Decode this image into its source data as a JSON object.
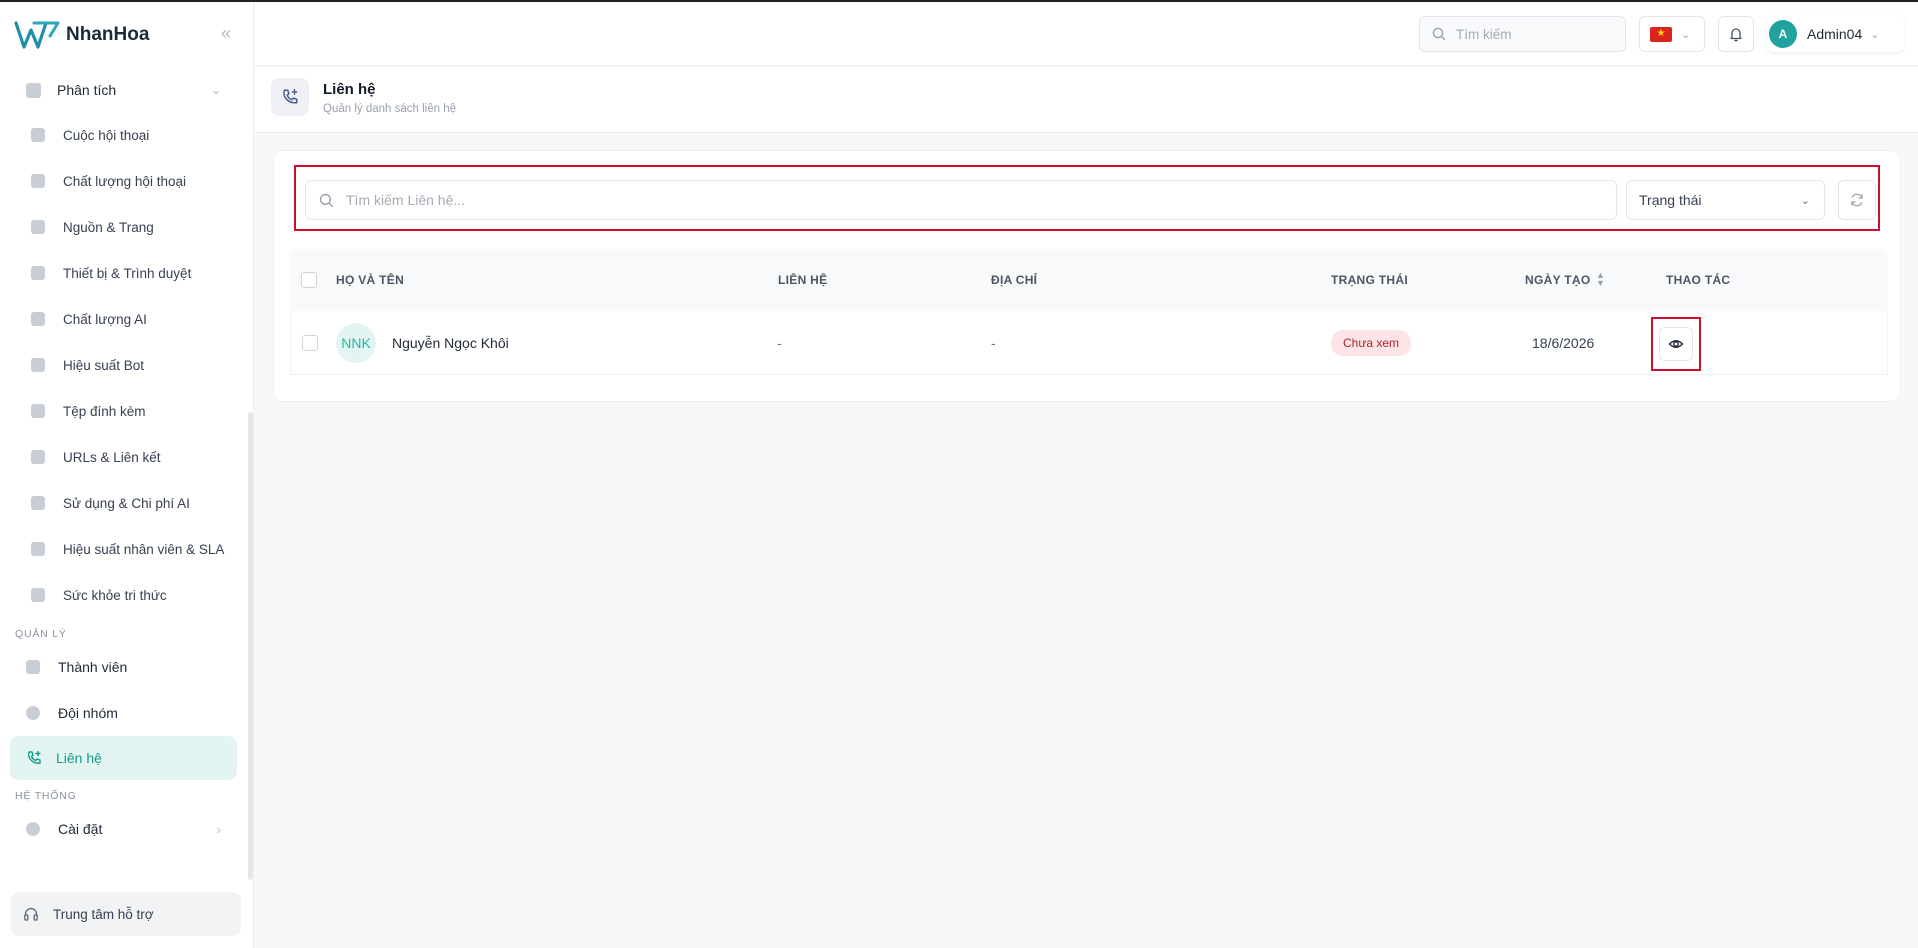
{
  "brand": {
    "name": "NhanHoa",
    "collapse_glyph": "«"
  },
  "sidebar": {
    "analytics_group": "Phân tích",
    "analytics_items": [
      {
        "label": "Cuộc hội thoại",
        "icon": "chat-bubbles-icon"
      },
      {
        "label": "Chất lượng hội thoại",
        "icon": "message-square-icon"
      },
      {
        "label": "Nguồn & Trang",
        "icon": "monitor-icon"
      },
      {
        "label": "Thiết bị & Trình duyệt",
        "icon": "phone-device-icon"
      },
      {
        "label": "Chất lượng AI",
        "icon": "sparkles-icon"
      },
      {
        "label": "Hiệu suất Bot",
        "icon": "cpu-icon"
      },
      {
        "label": "Tệp đính kèm",
        "icon": "file-icon"
      },
      {
        "label": "URLs & Liên kết",
        "icon": "link-icon"
      },
      {
        "label": "Sử dụng & Chi phí AI",
        "icon": "database-icon"
      },
      {
        "label": "Hiệu suất nhân viên & SLA",
        "icon": "users-icon"
      },
      {
        "label": "Sức khỏe tri thức",
        "icon": "book-icon"
      }
    ],
    "section_manage": "QUẢN LÝ",
    "manage_items": [
      {
        "label": "Thành viên",
        "icon": "user-card-icon"
      },
      {
        "label": "Đội nhóm",
        "icon": "team-icon"
      },
      {
        "label": "Liên hệ",
        "icon": "phone-plus-icon",
        "active": true
      }
    ],
    "section_system": "HỆ THỐNG",
    "system_items": [
      {
        "label": "Cài đặt",
        "icon": "gear-icon"
      }
    ],
    "support_label": "Trung tâm hỗ trợ"
  },
  "topbar": {
    "search_placeholder": "Tìm kiếm",
    "language_flag": "vietnam-flag-icon",
    "user_initial": "A",
    "user_name": "Admin04"
  },
  "page": {
    "title": "Liên hệ",
    "subtitle": "Quản lý danh sách liên hệ"
  },
  "filters": {
    "search_placeholder": "Tìm kiếm Liên hệ...",
    "status_label": "Trạng thái"
  },
  "table": {
    "headers": {
      "name": "HỌ VÀ TÊN",
      "contact": "LIÊN HỆ",
      "address": "ĐỊA CHỈ",
      "status": "TRẠNG THÁI",
      "created": "NGÀY TẠO",
      "actions": "THAO TÁC"
    },
    "rows": [
      {
        "initials": "NNK",
        "name": "Nguyễn Ngọc Khôi",
        "contact": "-",
        "address": "-",
        "status": "Chưa xem",
        "created": "18/6/2026"
      }
    ]
  },
  "colors": {
    "accent": "#15998a",
    "active_bg": "#e3f5f2",
    "highlight_border": "#c8102e",
    "badge_bg": "#fde4e6",
    "badge_text": "#b4232e"
  }
}
